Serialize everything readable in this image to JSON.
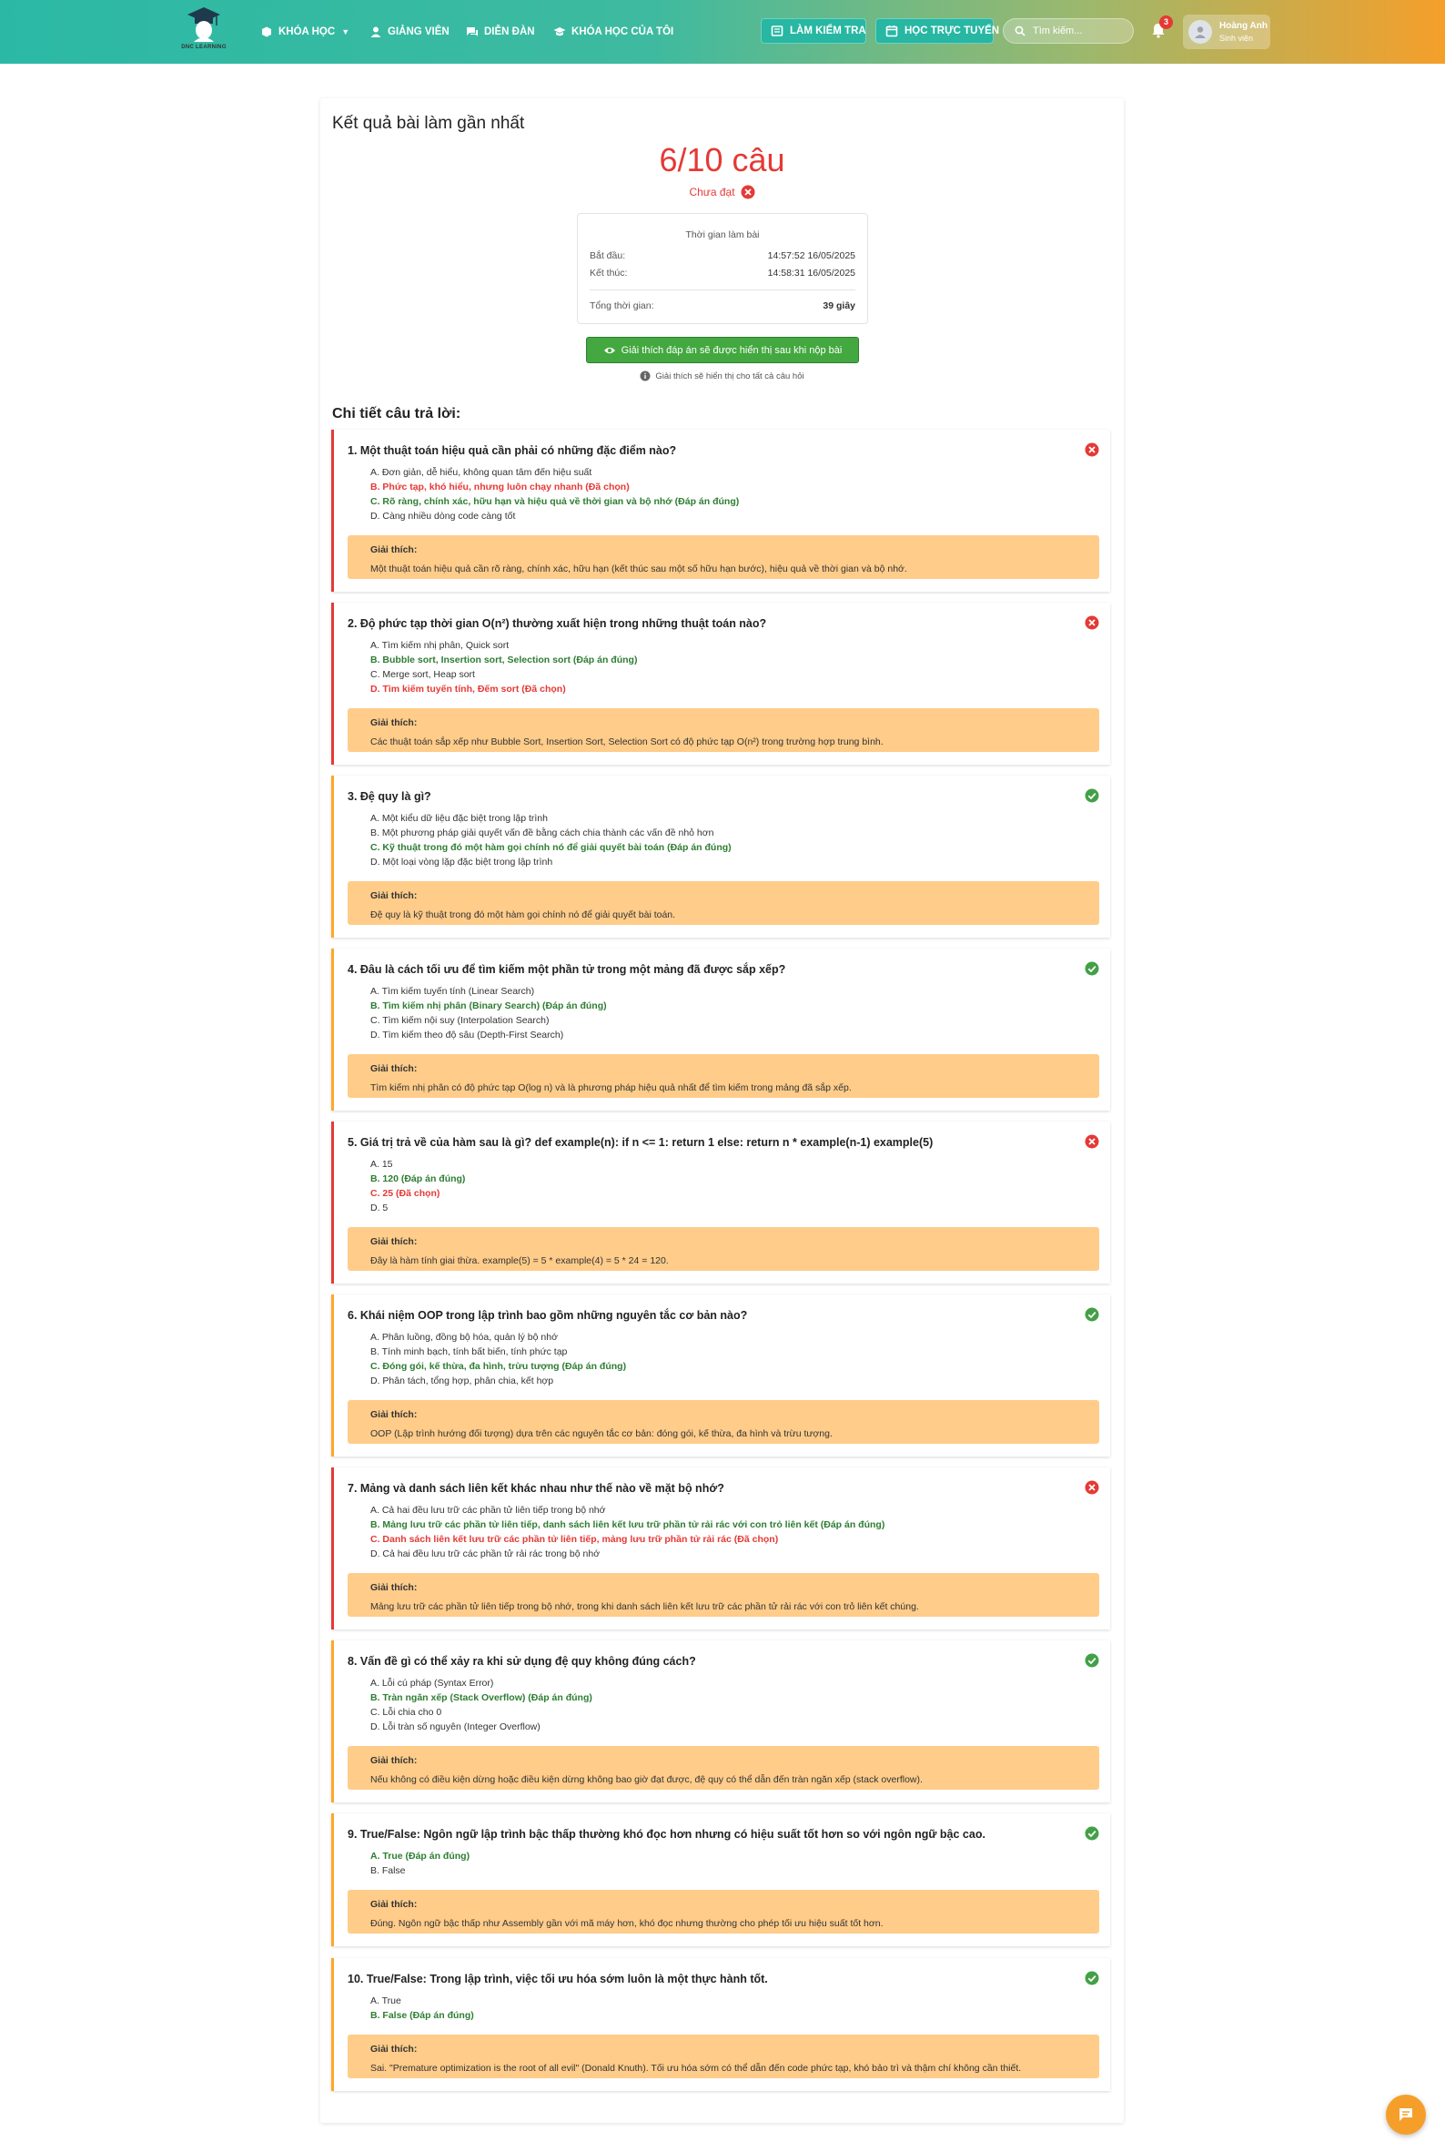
{
  "brand": {
    "logo_text": "DNC LEARNING"
  },
  "nav": {
    "courses": "KHÓA HỌC",
    "lecturers": "GIẢNG VIÊN",
    "forum": "DIỄN ĐÀN",
    "my_courses": "KHÓA HỌC CỦA TÔI",
    "take_test": "LÀM KIỂM TRA",
    "online_learning": "HỌC TRỰC TUYẾN"
  },
  "search": {
    "placeholder": "Tìm kiếm..."
  },
  "notifications": {
    "count": "3"
  },
  "user": {
    "name": "Hoàng Anh",
    "role": "Sinh viên"
  },
  "result": {
    "heading": "Kết quả bài làm gần nhất",
    "score": "6/10 câu",
    "status": "Chưa đạt",
    "time_title": "Thời gian làm bài",
    "start_label": "Bắt đầu:",
    "start_value": "14:57:52 16/05/2025",
    "end_label": "Kết thúc:",
    "end_value": "14:58:31 16/05/2025",
    "total_label": "Tổng thời gian:",
    "total_value": "39 giây",
    "explain_button": "Giải thích đáp án sẽ được hiển thị sau khi nộp bài",
    "explain_note": "Giải thích sẽ hiển thị cho tất cả câu hỏi",
    "detail_heading": "Chi tiết câu trả lời:"
  },
  "explanation_label": "Giải thích:",
  "questions": [
    {
      "title": "1. Một thuật toán hiệu quả cần phải có những đặc điểm nào?",
      "correct": false,
      "options": [
        {
          "text": "A. Đơn giản, dễ hiểu, không quan tâm đến hiệu suất",
          "state": "none"
        },
        {
          "text": "B. Phức tạp, khó hiểu, nhưng luôn chạy nhanh (Đã chọn)",
          "state": "chosen"
        },
        {
          "text": "C. Rõ ràng, chính xác, hữu hạn và hiệu quả về thời gian và bộ nhớ (Đáp án đúng)",
          "state": "answer"
        },
        {
          "text": "D. Càng nhiều dòng code càng tốt",
          "state": "none"
        }
      ],
      "explanation": "Một thuật toán hiệu quả cần rõ ràng, chính xác, hữu hạn (kết thúc sau một số hữu hạn bước), hiệu quả về thời gian và bộ nhớ."
    },
    {
      "title": "2. Độ phức tạp thời gian O(n²) thường xuất hiện trong những thuật toán nào?",
      "correct": false,
      "options": [
        {
          "text": "A. Tìm kiếm nhị phân, Quick sort",
          "state": "none"
        },
        {
          "text": "B. Bubble sort, Insertion sort, Selection sort (Đáp án đúng)",
          "state": "answer"
        },
        {
          "text": "C. Merge sort, Heap sort",
          "state": "none"
        },
        {
          "text": "D. Tìm kiếm tuyến tính, Đếm sort (Đã chọn)",
          "state": "chosen"
        }
      ],
      "explanation": "Các thuật toán sắp xếp như Bubble Sort, Insertion Sort, Selection Sort có độ phức tạp O(n²) trong trường hợp trung bình."
    },
    {
      "title": "3. Đệ quy là gì?",
      "correct": true,
      "options": [
        {
          "text": "A. Một kiểu dữ liệu đặc biệt trong lập trình",
          "state": "none"
        },
        {
          "text": "B. Một phương pháp giải quyết vấn đề bằng cách chia thành các vấn đề nhỏ hơn",
          "state": "none"
        },
        {
          "text": "C. Kỹ thuật trong đó một hàm gọi chính nó để giải quyết bài toán (Đáp án đúng)",
          "state": "answer"
        },
        {
          "text": "D. Một loại vòng lặp đặc biệt trong lập trình",
          "state": "none"
        }
      ],
      "explanation": "Đệ quy là kỹ thuật trong đó một hàm gọi chính nó để giải quyết bài toán."
    },
    {
      "title": "4. Đâu là cách tối ưu để tìm kiếm một phần tử trong một mảng đã được sắp xếp?",
      "correct": true,
      "options": [
        {
          "text": "A. Tìm kiếm tuyến tính (Linear Search)",
          "state": "none"
        },
        {
          "text": "B. Tìm kiếm nhị phân (Binary Search) (Đáp án đúng)",
          "state": "answer"
        },
        {
          "text": "C. Tìm kiếm nội suy (Interpolation Search)",
          "state": "none"
        },
        {
          "text": "D. Tìm kiếm theo độ sâu (Depth-First Search)",
          "state": "none"
        }
      ],
      "explanation": "Tìm kiếm nhị phân có độ phức tạp O(log n) và là phương pháp hiệu quả nhất để tìm kiếm trong mảng đã sắp xếp."
    },
    {
      "title": "5. Giá trị trả về của hàm sau là gì? def example(n): if n <= 1: return 1 else: return n * example(n-1) example(5)",
      "correct": false,
      "options": [
        {
          "text": "A. 15",
          "state": "none"
        },
        {
          "text": "B. 120 (Đáp án đúng)",
          "state": "answer"
        },
        {
          "text": "C. 25 (Đã chọn)",
          "state": "chosen"
        },
        {
          "text": "D. 5",
          "state": "none"
        }
      ],
      "explanation": "Đây là hàm tính giai thừa. example(5) = 5 * example(4) = 5 * 24 = 120."
    },
    {
      "title": "6. Khái niệm OOP trong lập trình bao gồm những nguyên tắc cơ bản nào?",
      "correct": true,
      "options": [
        {
          "text": "A. Phân luồng, đồng bộ hóa, quản lý bộ nhớ",
          "state": "none"
        },
        {
          "text": "B. Tính minh bạch, tính bất biến, tính phức tạp",
          "state": "none"
        },
        {
          "text": "C. Đóng gói, kế thừa, đa hình, trừu tượng (Đáp án đúng)",
          "state": "answer"
        },
        {
          "text": "D. Phân tách, tổng hợp, phân chia, kết hợp",
          "state": "none"
        }
      ],
      "explanation": "OOP (Lập trình hướng đối tượng) dựa trên các nguyên tắc cơ bản: đóng gói, kế thừa, đa hình và trừu tượng."
    },
    {
      "title": "7. Mảng và danh sách liên kết khác nhau như thế nào về mặt bộ nhớ?",
      "correct": false,
      "options": [
        {
          "text": "A. Cả hai đều lưu trữ các phần tử liên tiếp trong bộ nhớ",
          "state": "none"
        },
        {
          "text": "B. Mảng lưu trữ các phần tử liên tiếp, danh sách liên kết lưu trữ phần tử rải rác với con trỏ liên kết (Đáp án đúng)",
          "state": "answer"
        },
        {
          "text": "C. Danh sách liên kết lưu trữ các phần tử liên tiếp, mảng lưu trữ phần tử rải rác (Đã chọn)",
          "state": "chosen"
        },
        {
          "text": "D. Cả hai đều lưu trữ các phần tử rải rác trong bộ nhớ",
          "state": "none"
        }
      ],
      "explanation": "Mảng lưu trữ các phần tử liên tiếp trong bộ nhớ, trong khi danh sách liên kết lưu trữ các phần tử rải rác với con trỏ liên kết chúng."
    },
    {
      "title": "8. Vấn đề gì có thể xảy ra khi sử dụng đệ quy không đúng cách?",
      "correct": true,
      "options": [
        {
          "text": "A. Lỗi cú pháp (Syntax Error)",
          "state": "none"
        },
        {
          "text": "B. Tràn ngăn xếp (Stack Overflow) (Đáp án đúng)",
          "state": "answer"
        },
        {
          "text": "C. Lỗi chia cho 0",
          "state": "none"
        },
        {
          "text": "D. Lỗi tràn số nguyên (Integer Overflow)",
          "state": "none"
        }
      ],
      "explanation": "Nếu không có điều kiện dừng hoặc điều kiện dừng không bao giờ đạt được, đệ quy có thể dẫn đến tràn ngăn xếp (stack overflow)."
    },
    {
      "title": "9. True/False: Ngôn ngữ lập trình bậc thấp thường khó đọc hơn nhưng có hiệu suất tốt hơn so với ngôn ngữ bậc cao.",
      "correct": true,
      "options": [
        {
          "text": "A. True (Đáp án đúng)",
          "state": "answer"
        },
        {
          "text": "B. False",
          "state": "none"
        }
      ],
      "explanation": "Đúng. Ngôn ngữ bậc thấp như Assembly gần với mã máy hơn, khó đọc nhưng thường cho phép tối ưu hiệu suất tốt hơn."
    },
    {
      "title": "10. True/False: Trong lập trình, việc tối ưu hóa sớm luôn là một thực hành tốt.",
      "correct": true,
      "options": [
        {
          "text": "A. True",
          "state": "none"
        },
        {
          "text": "B. False (Đáp án đúng)",
          "state": "answer"
        }
      ],
      "explanation": "Sai. \"Premature optimization is the root of all evil\" (Donald Knuth). Tối ưu hóa sớm có thể dẫn đến code phức tạp, khó bảo trì và thậm chí không cần thiết."
    }
  ],
  "colors": {
    "wrong": "#e53935",
    "correct": "#43a047",
    "accent": "#ffa726",
    "explanation_bg": "#ffcc8a"
  },
  "icons": {
    "chat": "chat-icon",
    "status_wrong": "x-circle-icon",
    "status_correct": "check-circle-icon"
  }
}
